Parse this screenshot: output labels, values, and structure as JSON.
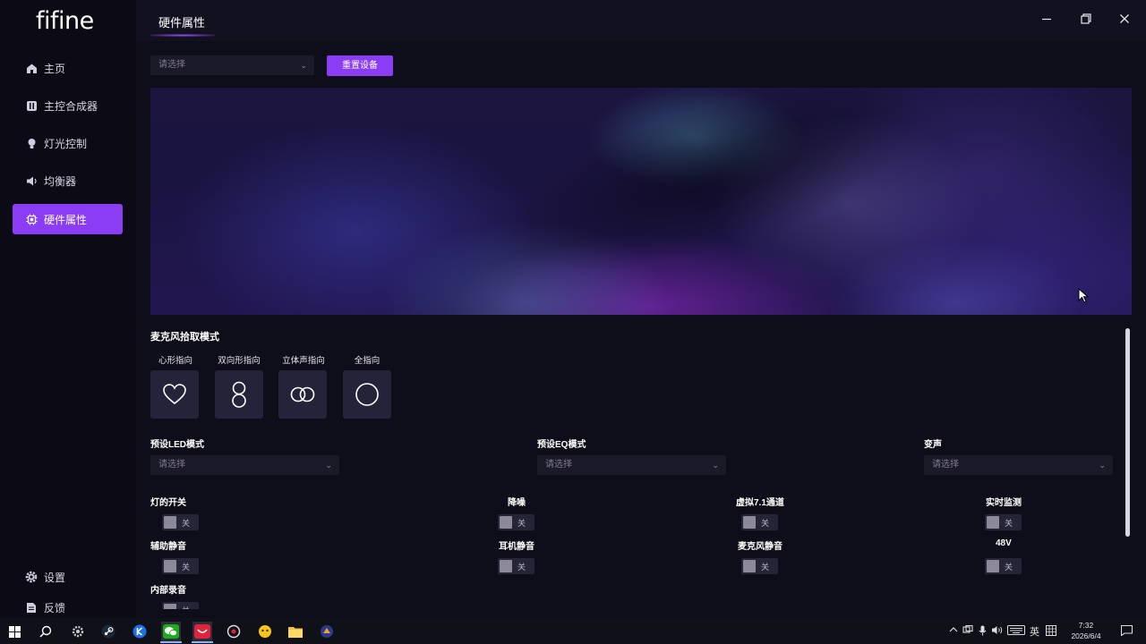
{
  "app": {
    "logo": "fifine"
  },
  "header": {
    "title": "硬件属性"
  },
  "sidebar": {
    "items": [
      {
        "label": "主页",
        "icon": "home-icon"
      },
      {
        "label": "主控合成器",
        "icon": "mixer-icon"
      },
      {
        "label": "灯光控制",
        "icon": "bulb-icon"
      },
      {
        "label": "均衡器",
        "icon": "speaker-icon"
      },
      {
        "label": "硬件属性",
        "icon": "chip-icon",
        "active": true
      }
    ],
    "bottom": [
      {
        "label": "设置",
        "icon": "gear-icon"
      },
      {
        "label": "反馈",
        "icon": "feedback-icon"
      }
    ]
  },
  "top": {
    "device_select_placeholder": "请选择",
    "reset_button": "重置设备"
  },
  "mic_pattern": {
    "title": "麦克风拾取模式",
    "options": [
      {
        "label": "心形指向",
        "icon": "heart-icon"
      },
      {
        "label": "双向形指向",
        "icon": "figure-eight-icon"
      },
      {
        "label": "立体声指向",
        "icon": "stereo-icon"
      },
      {
        "label": "全指向",
        "icon": "circle-icon"
      }
    ]
  },
  "selects": [
    {
      "label": "预设LED模式",
      "placeholder": "请选择"
    },
    {
      "label": "预设EQ模式",
      "placeholder": "请选择"
    },
    {
      "label": "变声",
      "placeholder": "请选择"
    }
  ],
  "toggles": [
    {
      "label": "灯的开关",
      "state": "关"
    },
    {
      "label": "降噪",
      "state": "关"
    },
    {
      "label": "虚拟7.1通道",
      "state": "关"
    },
    {
      "label": "实时监测",
      "state": "关"
    },
    {
      "label": "辅助静音",
      "state": "关"
    },
    {
      "label": "耳机静音",
      "state": "关"
    },
    {
      "label": "麦克风静音",
      "state": "关"
    },
    {
      "label": "48V",
      "state": "关"
    },
    {
      "label": "内部录音",
      "state": "关"
    }
  ],
  "taskbar": {
    "ime": "英",
    "time": "7:32",
    "date": "2026/6/4"
  },
  "colors": {
    "accent": "#8b3cf5",
    "background": "#0e0d1a",
    "card": "#24233a"
  }
}
